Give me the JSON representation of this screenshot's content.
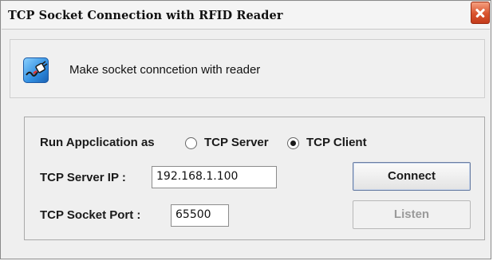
{
  "window": {
    "title": "TCP Socket Connection with RFID Reader"
  },
  "header": {
    "text": "Make socket conncetion with reader",
    "icon": "plug-icon"
  },
  "form": {
    "run_as_label": "Run Appclication as",
    "mode_options": [
      {
        "label": "TCP Server",
        "selected": false
      },
      {
        "label": "TCP Client",
        "selected": true
      }
    ],
    "server_ip_label": "TCP Server IP :",
    "server_ip_value": "192.168.1.100",
    "port_label": "TCP Socket Port :",
    "port_value": "65500"
  },
  "buttons": {
    "connect": "Connect",
    "listen": "Listen"
  },
  "colors": {
    "close_button": "#d9532e",
    "icon_blue": "#2f8de0"
  }
}
